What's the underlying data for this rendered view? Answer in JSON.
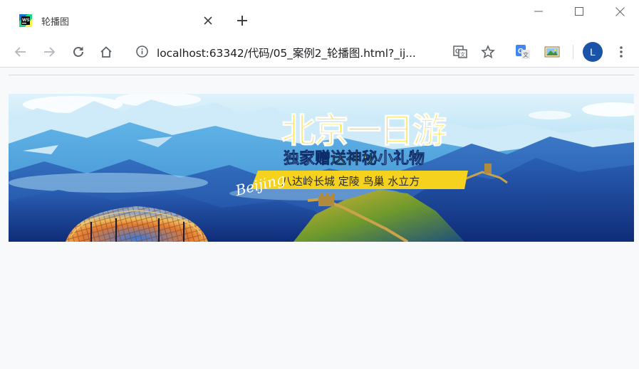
{
  "tab": {
    "title": "轮播图",
    "favicon": "webstorm-icon"
  },
  "toolbar": {
    "url": "localhost:63342/代码/05_案例2_轮播图.html?_ij..."
  },
  "profile": {
    "initial": "L"
  },
  "banner": {
    "headline": "北京一日游",
    "tagline_part1": "独家",
    "tagline_highlight": "赠送神秘",
    "tagline_part2": "小礼物",
    "script_text": "Beijing",
    "sites": "八达岭长城  定陵  鸟巢  水立方"
  },
  "colors": {
    "accent_yellow": "#f5d21e",
    "sky_blue": "#7cc8ee",
    "mountain_blue": "#1f4ea3",
    "avatar_blue": "#1a53a8",
    "divider_line": "#f2d890"
  }
}
